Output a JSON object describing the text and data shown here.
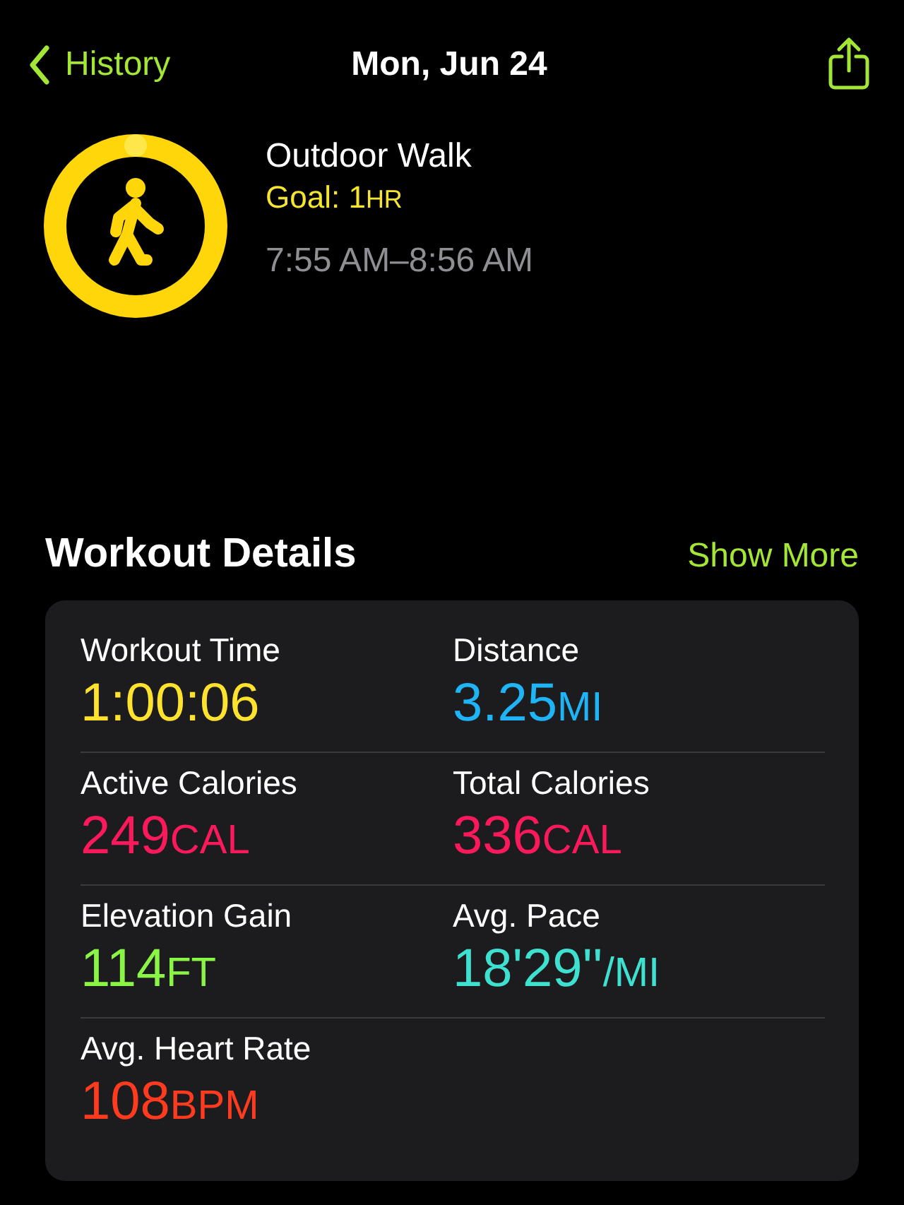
{
  "nav": {
    "back_label": "History",
    "title": "Mon, Jun 24"
  },
  "workout": {
    "name": "Outdoor Walk",
    "goal": {
      "text": "Goal: 1",
      "unit": "HR"
    },
    "time_range": "7:55 AM–8:56 AM"
  },
  "section": {
    "title": "Workout Details",
    "action": "Show More"
  },
  "metrics": [
    {
      "label": "Workout Time",
      "value": "1:00:06",
      "color": "#ffe22e"
    },
    {
      "label": "Distance",
      "value": "3.25",
      "unit": "MI",
      "color": "#1fb4f5"
    },
    {
      "label": "Active Calories",
      "value": "249",
      "unit": "CAL",
      "color": "#fa1a5c"
    },
    {
      "label": "Total Calories",
      "value": "336",
      "unit": "CAL",
      "color": "#fa1a5c"
    },
    {
      "label": "Elevation Gain",
      "value": "114",
      "unit": "FT",
      "color": "#8bf546"
    },
    {
      "label": "Avg. Pace",
      "value": "18'29''",
      "unit": "/MI",
      "color": "#3ee0d0"
    },
    {
      "label": "Avg. Heart Rate",
      "value": "108",
      "unit": "BPM",
      "color": "#ff3b1f"
    }
  ]
}
